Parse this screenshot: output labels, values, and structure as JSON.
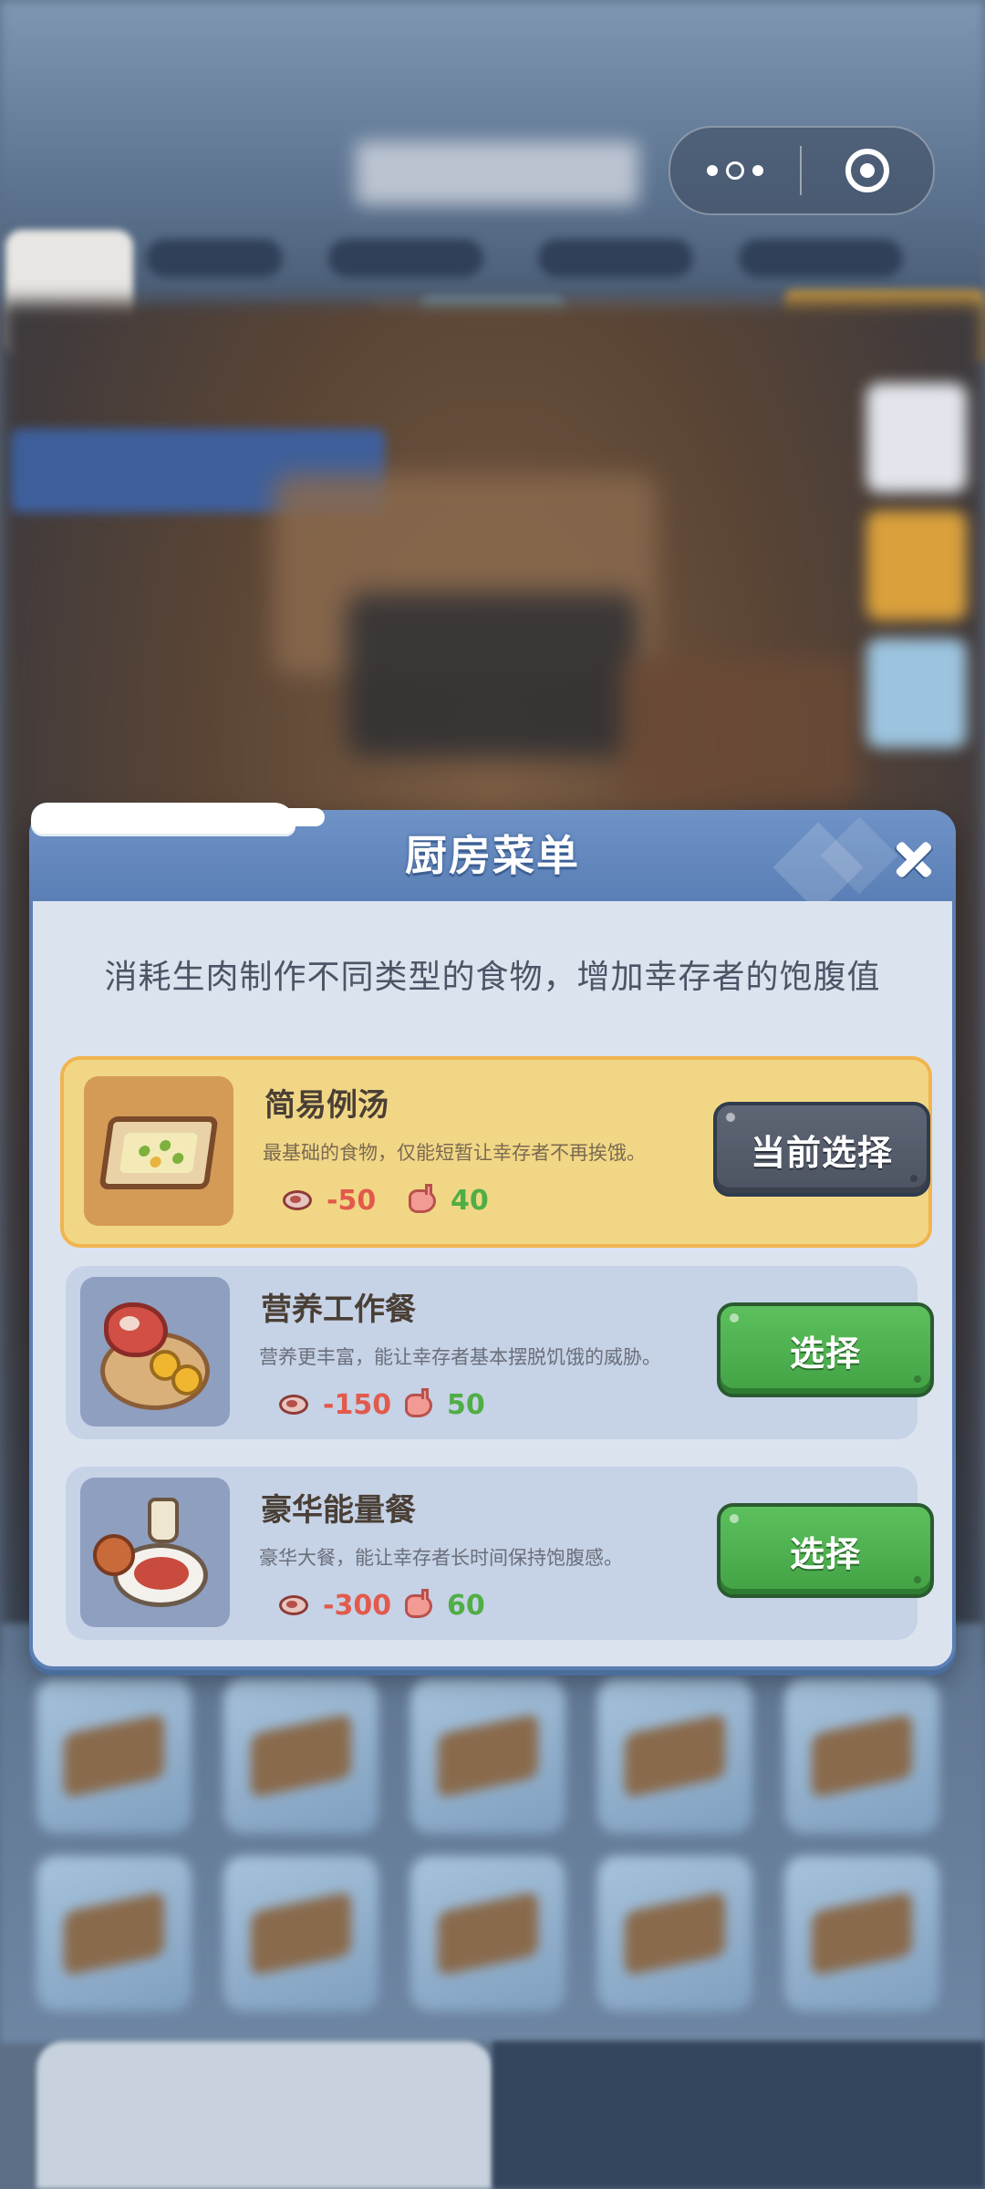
{
  "dialog": {
    "title": "厨房菜单",
    "description": "消耗生肉制作不同类型的食物，增加幸存者的饱腹值"
  },
  "menu": [
    {
      "name": "简易例汤",
      "description": "最基础的食物，仅能短暂让幸存者不再挨饿。",
      "meat_cost": "-50",
      "satiety_gain": "40",
      "button_label": "当前选择",
      "selected": true,
      "icon": "soup-tray-icon"
    },
    {
      "name": "营养工作餐",
      "description": "营养更丰富，能让幸存者基本摆脱饥饿的威胁。",
      "meat_cost": "-150",
      "satiety_gain": "50",
      "button_label": "选择",
      "selected": false,
      "icon": "steak-plate-icon"
    },
    {
      "name": "豪华能量餐",
      "description": "豪华大餐，能让幸存者长时间保持饱腹感。",
      "meat_cost": "-300",
      "satiety_gain": "60",
      "button_label": "选择",
      "selected": false,
      "icon": "feast-plate-icon"
    }
  ],
  "icons": {
    "cost": "raw-meat-icon",
    "gain": "stomach-icon",
    "close": "close-icon",
    "capsule_more": "more-dots-icon",
    "capsule_exit": "exit-target-icon"
  },
  "colors": {
    "header_blue": "#5a7fb6",
    "selected_card": "#f1d785",
    "cost_red": "#e25a4c",
    "gain_green": "#4fae45",
    "button_green": "#4caf50",
    "button_gray": "#545b69"
  }
}
